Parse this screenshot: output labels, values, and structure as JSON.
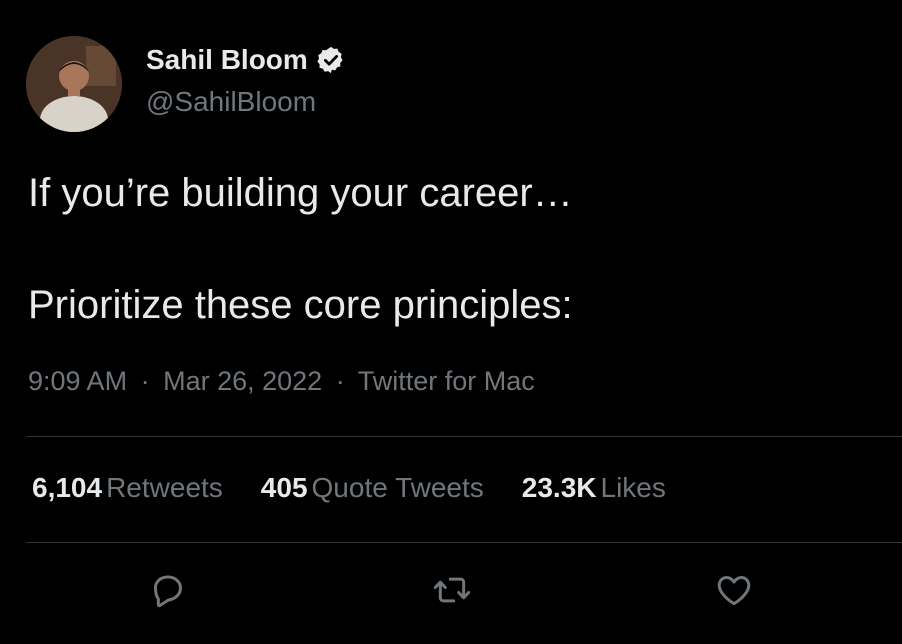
{
  "author": {
    "display_name": "Sahil Bloom",
    "handle": "@SahilBloom",
    "verified": true
  },
  "tweet": {
    "lines": [
      "If you’re building your career…",
      "Prioritize these core principles:"
    ],
    "time": "9:09 AM",
    "separator": "·",
    "date": "Mar 26, 2022",
    "source": "Twitter for Mac"
  },
  "stats": {
    "retweets": {
      "count": "6,104",
      "label": "Retweets"
    },
    "quotes": {
      "count": "405",
      "label": "Quote Tweets"
    },
    "likes": {
      "count": "23.3K",
      "label": "Likes"
    }
  },
  "colors": {
    "background": "#000000",
    "primary_text": "#e7e9ea",
    "secondary_text": "#71767b",
    "divider": "#2f3336"
  },
  "icons": {
    "reply": "speech-bubble-icon",
    "retweet": "retweet-arrows-icon",
    "like": "heart-icon",
    "verified": "verified-badge-icon"
  }
}
